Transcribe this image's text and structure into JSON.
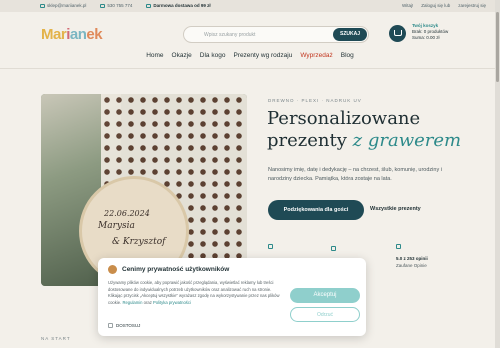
{
  "topbar": {
    "email": "sklep@mariianek.pl",
    "phone": "530 755 774",
    "shipping_prefix": "Darmowa dostawa od",
    "shipping_amount": "99 zł",
    "links": [
      "Witaj!",
      "Zaloguj się lub",
      "zarejestruj się"
    ]
  },
  "header": {
    "logo": [
      "Mar",
      "i",
      "an",
      "ek"
    ],
    "search_placeholder": "Wpisz szukany produkt",
    "search_button": "SZUKAJ",
    "cart_title": "Twój koszyk",
    "cart_count": "Brak: 0 produktów",
    "cart_sum": "Suma: 0.00 zł"
  },
  "nav": {
    "items": [
      "Home",
      "Okazje",
      "Dla kogo",
      "Prezenty wg rodzaju",
      "Wyprzedaż",
      "Blog"
    ]
  },
  "hero": {
    "image_text": [
      "22.06.2024",
      "Marysia",
      "& Krzysztof"
    ],
    "eyebrow": "DREWNO · PLEXI · NADRUK UV",
    "title_line1": "Personalizowane",
    "title_line2": "prezenty",
    "title_em": "z grawerem",
    "lead": "Nanosimy imię, datę i dedykację – na chrzest, ślub, komunię, urodziny i narodziny dziecka. Pamiątka, która zostaje na lata.",
    "cta_primary": "Podziękowania dla gości",
    "cta_secondary": "Wszystkie prezenty",
    "feature_title": "5.0 z 253 opinii",
    "feature_sub": "Zaufane Opinie"
  },
  "section": {
    "label": "NA START"
  },
  "cookie": {
    "title": "Cenimy prywatność użytkowników",
    "body": "Używamy plików cookie, aby poprawić jakość przeglądania, wyświetlać reklamy lub treści dostosowane do indywidualnych potrzeb użytkowników oraz analizować ruch na stronie. Klikając przycisk „Akceptuj wszystkie” wyrażasz zgodę na wykorzystywanie przez nas plików cookie.",
    "link1": "Regulamin",
    "and": "oraz",
    "link2": "Polityka prywatności",
    "checkbox": "DOSTOSUJ",
    "accept": "Akceptuj",
    "reject": "Odrzuć"
  }
}
